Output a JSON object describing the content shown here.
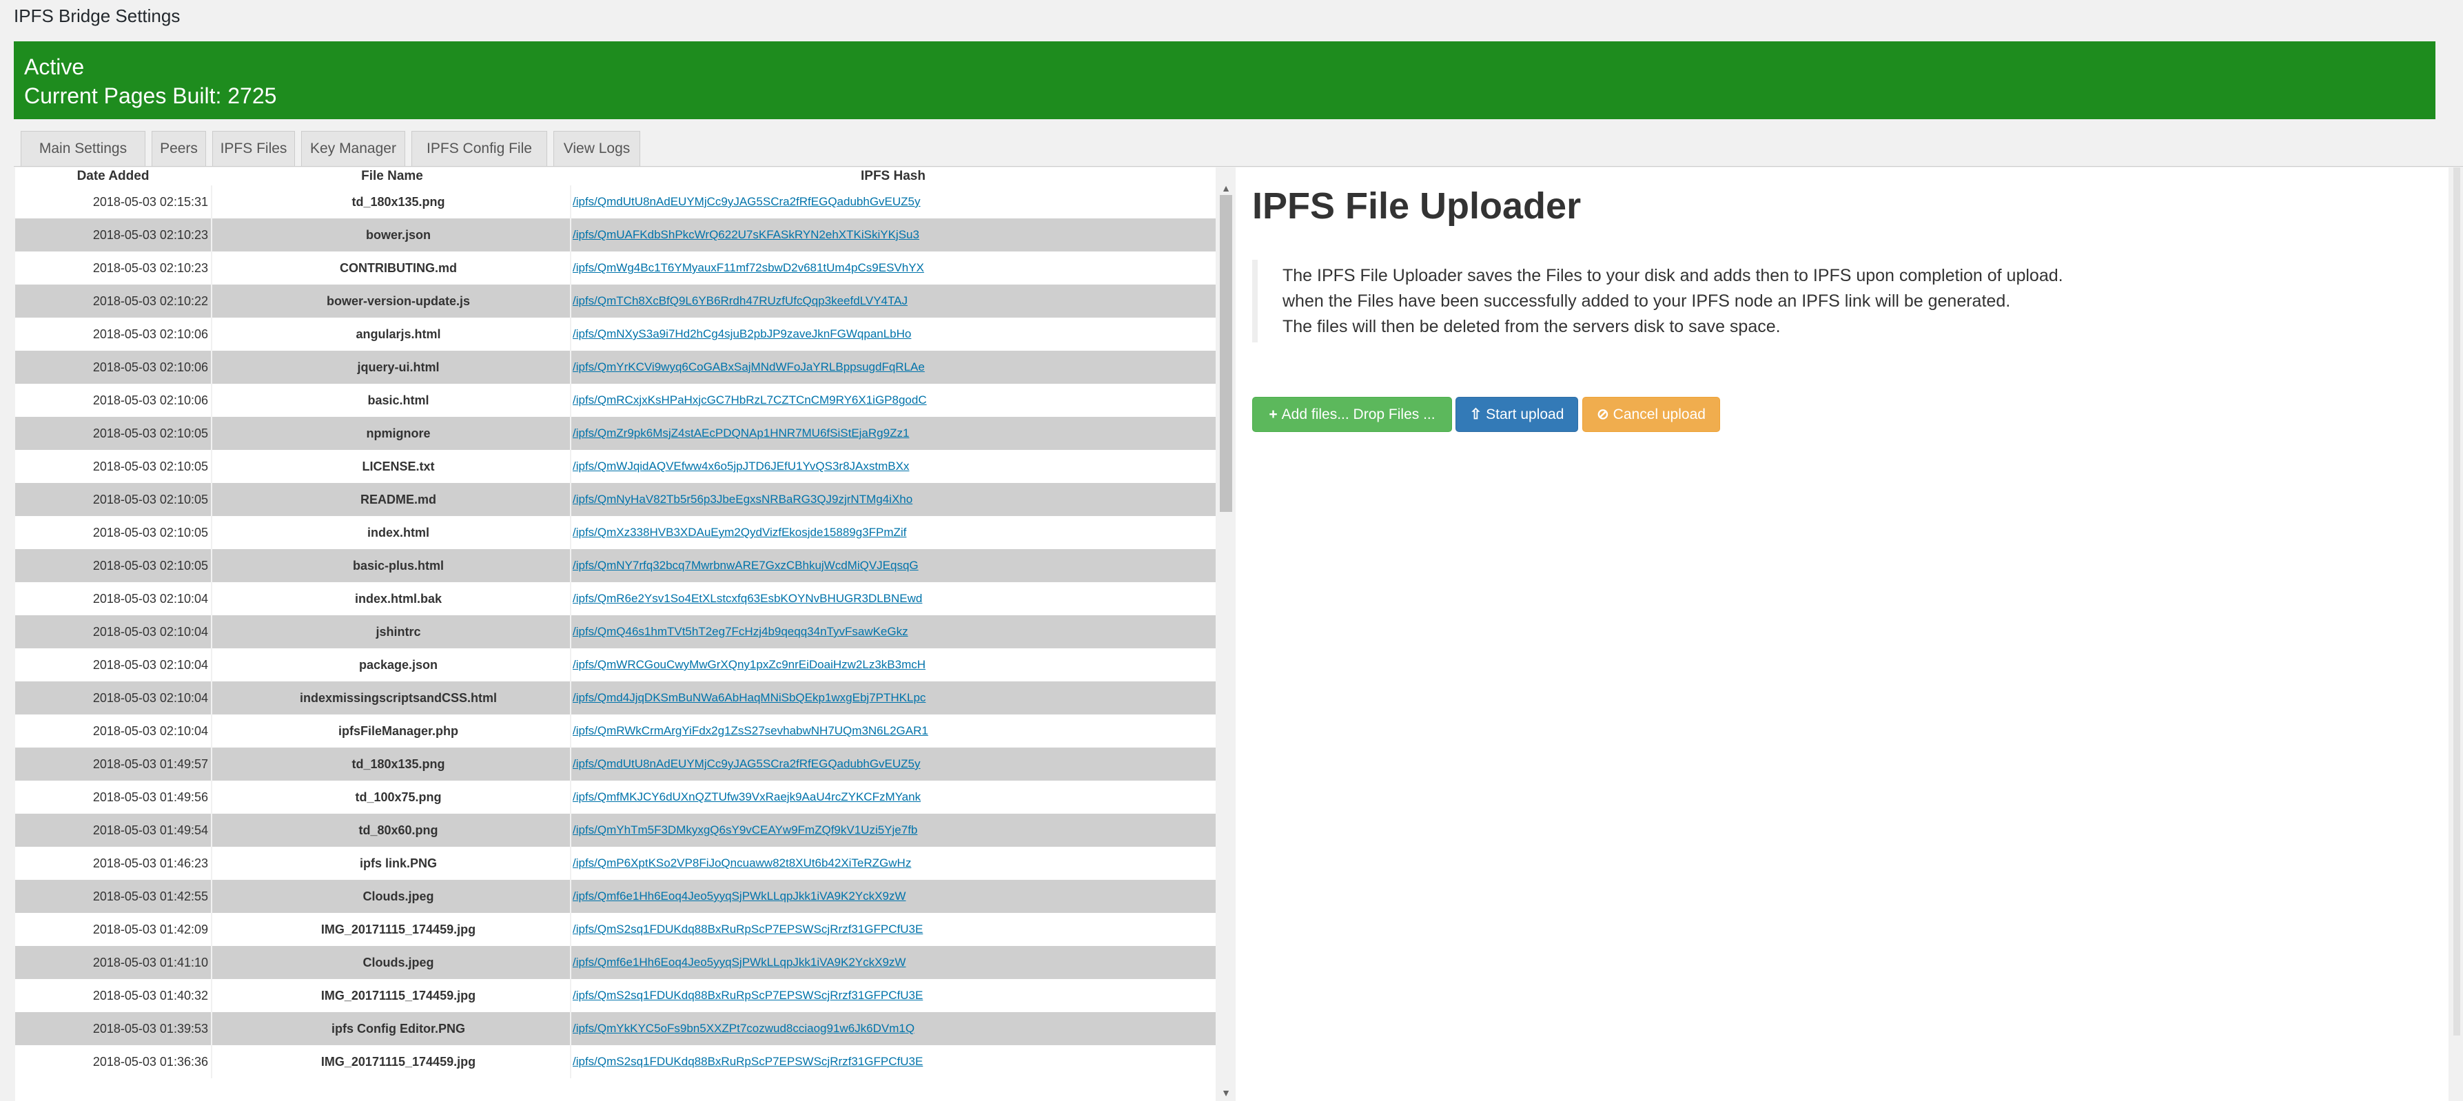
{
  "page": {
    "title": "IPFS Bridge Settings"
  },
  "status": {
    "state": "Active",
    "pages_built": "Current Pages Built: 2725"
  },
  "tabs": [
    {
      "label": "Main Settings"
    },
    {
      "label": "Peers"
    },
    {
      "label": "IPFS Files"
    },
    {
      "label": "Key Manager"
    },
    {
      "label": "IPFS Config File"
    },
    {
      "label": "View Logs"
    }
  ],
  "table": {
    "headers": {
      "date": "Date Added",
      "name": "File Name",
      "hash": "IPFS Hash"
    },
    "rows": [
      {
        "date": "2018-05-03 02:15:31",
        "name": "td_180x135.png",
        "hash": "/ipfs/QmdUtU8nAdEUYMjCc9yJAG5SCra2fRfEGQadubhGvEUZ5y"
      },
      {
        "date": "2018-05-03 02:10:23",
        "name": "bower.json",
        "hash": "/ipfs/QmUAFKdbShPkcWrQ622U7sKFASkRYN2ehXTKiSkiYKjSu3"
      },
      {
        "date": "2018-05-03 02:10:23",
        "name": "CONTRIBUTING.md",
        "hash": "/ipfs/QmWg4Bc1T6YMyauxF11mf72sbwD2v681tUm4pCs9ESVhYX"
      },
      {
        "date": "2018-05-03 02:10:22",
        "name": "bower-version-update.js",
        "hash": "/ipfs/QmTCh8XcBfQ9L6YB6Rrdh47RUzfUfcQqp3keefdLVY4TAJ"
      },
      {
        "date": "2018-05-03 02:10:06",
        "name": "angularjs.html",
        "hash": "/ipfs/QmNXyS3a9i7Hd2hCg4sjuB2pbJP9zaveJknFGWqpanLbHo"
      },
      {
        "date": "2018-05-03 02:10:06",
        "name": "jquery-ui.html",
        "hash": "/ipfs/QmYrKCVi9wyq6CoGABxSajMNdWFoJaYRLBppsugdFqRLAe"
      },
      {
        "date": "2018-05-03 02:10:06",
        "name": "basic.html",
        "hash": "/ipfs/QmRCxjxKsHPaHxjcGC7HbRzL7CZTCnCM9RY6X1iGP8godC"
      },
      {
        "date": "2018-05-03 02:10:05",
        "name": "npmignore",
        "hash": "/ipfs/QmZr9pk6MsjZ4stAEcPDQNAp1HNR7MU6fSiStEjaRg9Zz1"
      },
      {
        "date": "2018-05-03 02:10:05",
        "name": "LICENSE.txt",
        "hash": "/ipfs/QmWJqidAQVEfww4x6o5jpJTD6JEfU1YvQS3r8JAxstmBXx"
      },
      {
        "date": "2018-05-03 02:10:05",
        "name": "README.md",
        "hash": "/ipfs/QmNyHaV82Tb5r56p3JbeEgxsNRBaRG3QJ9zjrNTMg4iXho"
      },
      {
        "date": "2018-05-03 02:10:05",
        "name": "index.html",
        "hash": "/ipfs/QmXz338HVB3XDAuEym2QydVizfEkosjde15889g3FPmZif"
      },
      {
        "date": "2018-05-03 02:10:05",
        "name": "basic-plus.html",
        "hash": "/ipfs/QmNY7rfq32bcq7MwrbnwARE7GxzCBhkujWcdMiQVJEqsqG"
      },
      {
        "date": "2018-05-03 02:10:04",
        "name": "index.html.bak",
        "hash": "/ipfs/QmR6e2Ysv1So4EtXLstcxfq63EsbKOYNvBHUGR3DLBNEwd"
      },
      {
        "date": "2018-05-03 02:10:04",
        "name": "jshintrc",
        "hash": "/ipfs/QmQ46s1hmTVt5hT2eg7FcHzj4b9qeqq34nTyvFsawKeGkz"
      },
      {
        "date": "2018-05-03 02:10:04",
        "name": "package.json",
        "hash": "/ipfs/QmWRCGouCwyMwGrXQny1pxZc9nrEiDoaiHzw2Lz3kB3mcH"
      },
      {
        "date": "2018-05-03 02:10:04",
        "name": "indexmissingscriptsandCSS.html",
        "hash": "/ipfs/Qmd4JjqDKSmBuNWa6AbHaqMNiSbQEkp1wxgEbj7PTHKLpc"
      },
      {
        "date": "2018-05-03 02:10:04",
        "name": "ipfsFileManager.php",
        "hash": "/ipfs/QmRWkCrmArgYiFdx2g1ZsS27sevhabwNH7UQm3N6L2GAR1"
      },
      {
        "date": "2018-05-03 01:49:57",
        "name": "td_180x135.png",
        "hash": "/ipfs/QmdUtU8nAdEUYMjCc9yJAG5SCra2fRfEGQadubhGvEUZ5y"
      },
      {
        "date": "2018-05-03 01:49:56",
        "name": "td_100x75.png",
        "hash": "/ipfs/QmfMKJCY6dUXnQZTUfw39VxRaejk9AaU4rcZYKCFzMYank"
      },
      {
        "date": "2018-05-03 01:49:54",
        "name": "td_80x60.png",
        "hash": "/ipfs/QmYhTm5F3DMkyxgQ6sY9vCEAYw9FmZQf9kV1Uzi5Yje7fb"
      },
      {
        "date": "2018-05-03 01:46:23",
        "name": "ipfs link.PNG",
        "hash": "/ipfs/QmP6XptKSo2VP8FiJoQncuaww82t8XUt6b42XiTeRZGwHz"
      },
      {
        "date": "2018-05-03 01:42:55",
        "name": "Clouds.jpeg",
        "hash": "/ipfs/Qmf6e1Hh6Eoq4Jeo5yyqSjPWkLLqpJkk1iVA9K2YckX9zW"
      },
      {
        "date": "2018-05-03 01:42:09",
        "name": "IMG_20171115_174459.jpg",
        "hash": "/ipfs/QmS2sq1FDUKdq88BxRuRpScP7EPSWScjRrzf31GFPCfU3E"
      },
      {
        "date": "2018-05-03 01:41:10",
        "name": "Clouds.jpeg",
        "hash": "/ipfs/Qmf6e1Hh6Eoq4Jeo5yyqSjPWkLLqpJkk1iVA9K2YckX9zW"
      },
      {
        "date": "2018-05-03 01:40:32",
        "name": "IMG_20171115_174459.jpg",
        "hash": "/ipfs/QmS2sq1FDUKdq88BxRuRpScP7EPSWScjRrzf31GFPCfU3E"
      },
      {
        "date": "2018-05-03 01:39:53",
        "name": "ipfs Config Editor.PNG",
        "hash": "/ipfs/QmYkKYC5oFs9bn5XXZPt7cozwud8cciaog91w6Jk6DVm1Q"
      },
      {
        "date": "2018-05-03 01:36:36",
        "name": "IMG_20171115_174459.jpg",
        "hash": "/ipfs/QmS2sq1FDUKdq88BxRuRpScP7EPSWScjRrzf31GFPCfU3E"
      }
    ]
  },
  "uploader": {
    "title": "IPFS File Uploader",
    "description": [
      "The IPFS File Uploader saves the Files to your disk and adds then to IPFS upon completion of upload.",
      "when the Files have been successfully added to your IPFS node an IPFS link will be generated.",
      "The files will then be deleted from the servers disk to save space."
    ],
    "buttons": {
      "add": {
        "label": "Add files... Drop Files ...",
        "icon": "plus-icon",
        "color": "#5cb85c"
      },
      "start": {
        "label": "Start upload",
        "icon": "upload-icon",
        "color": "#337ab7"
      },
      "cancel": {
        "label": "Cancel upload",
        "icon": "ban-icon",
        "color": "#f0ad4e"
      }
    }
  },
  "colors": {
    "status_banner": "#1e8c1e",
    "link": "#0073aa",
    "row_alt": "#cfcfcf"
  }
}
